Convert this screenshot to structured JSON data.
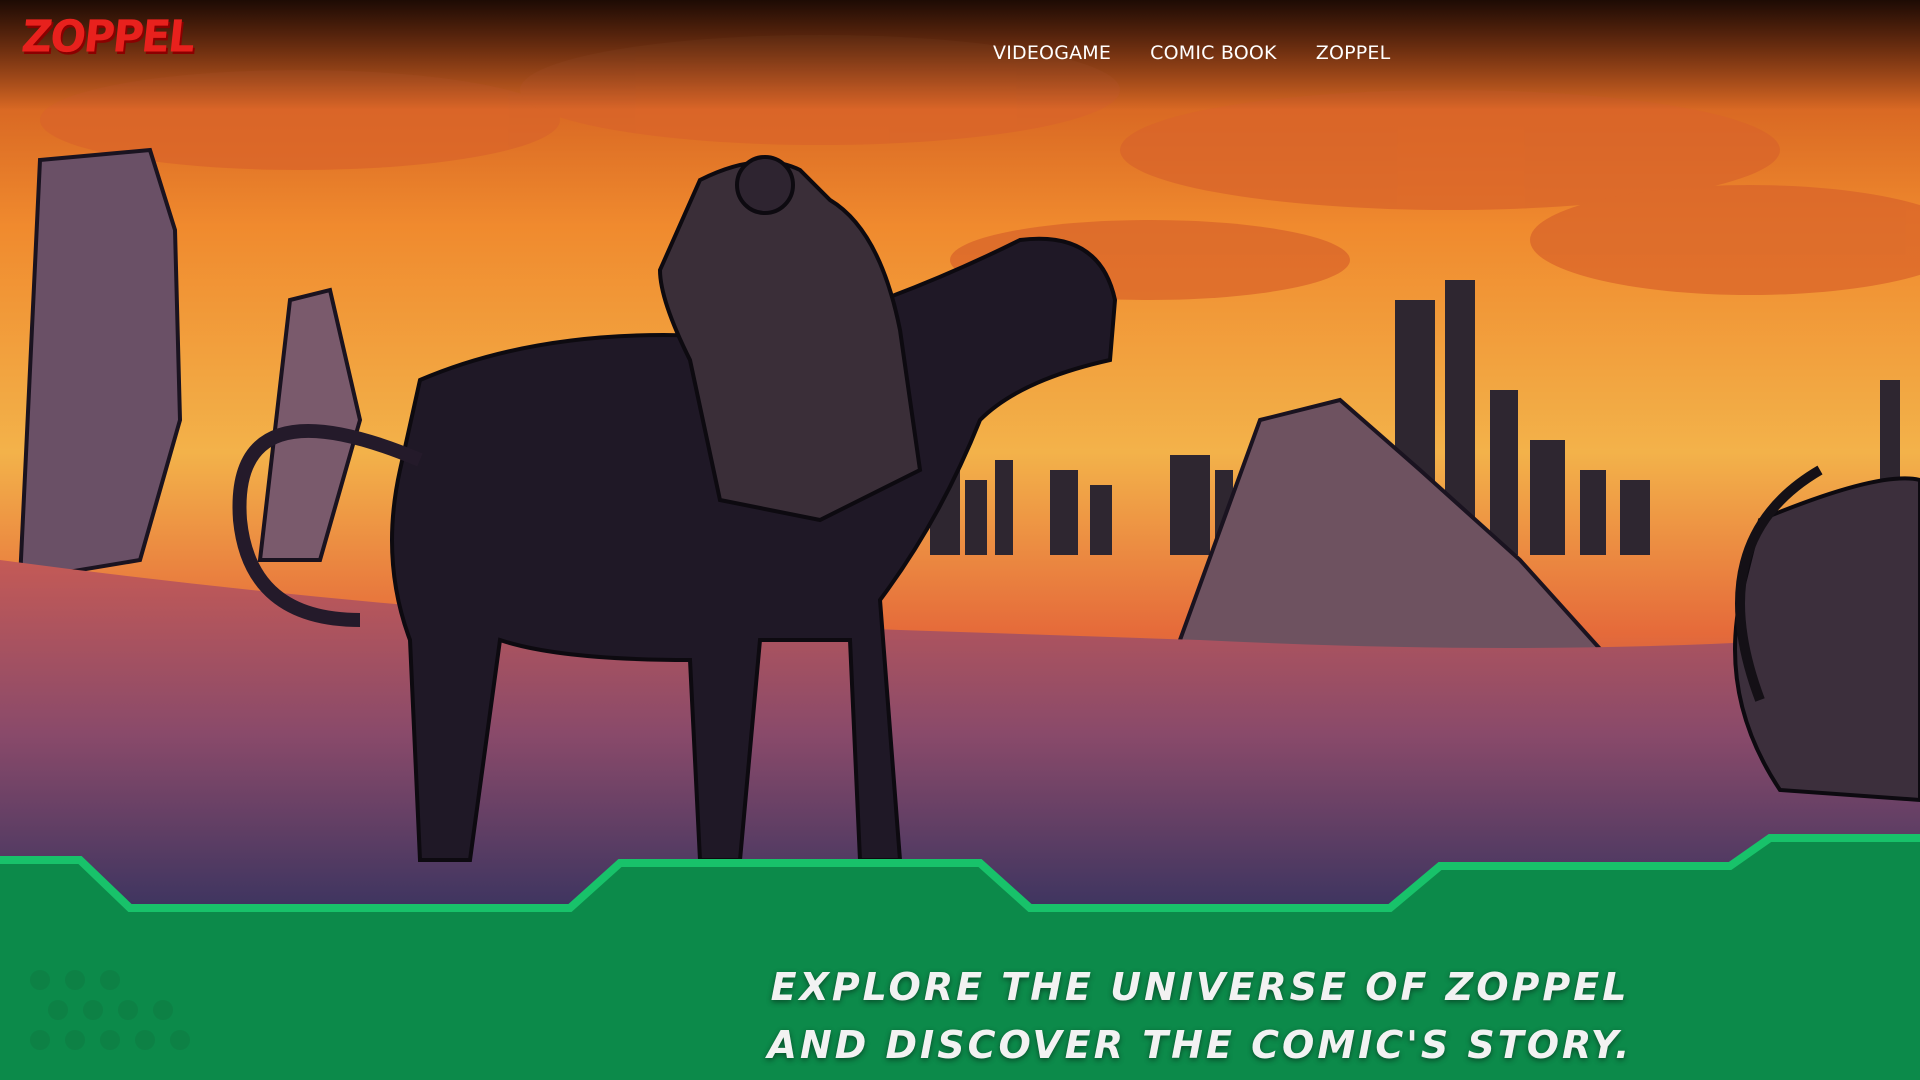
{
  "brand": {
    "logo_text": "ZOPPEL",
    "logo_color": "#e8211d"
  },
  "nav": {
    "items": [
      {
        "label": "VIDEOGAME"
      },
      {
        "label": "COMIC BOOK"
      },
      {
        "label": "ZOPPEL"
      }
    ]
  },
  "hero": {
    "image_subject": "rider-on-beast-in-ruined-wasteland-illustration"
  },
  "footer_band": {
    "headline_line1": "EXPLORE THE UNIVERSE OF ZOPPEL",
    "headline_line2": "AND DISCOVER THE COMIC'S STORY.",
    "band_color": "#0c8a4a",
    "edge_color": "#18c26a"
  }
}
